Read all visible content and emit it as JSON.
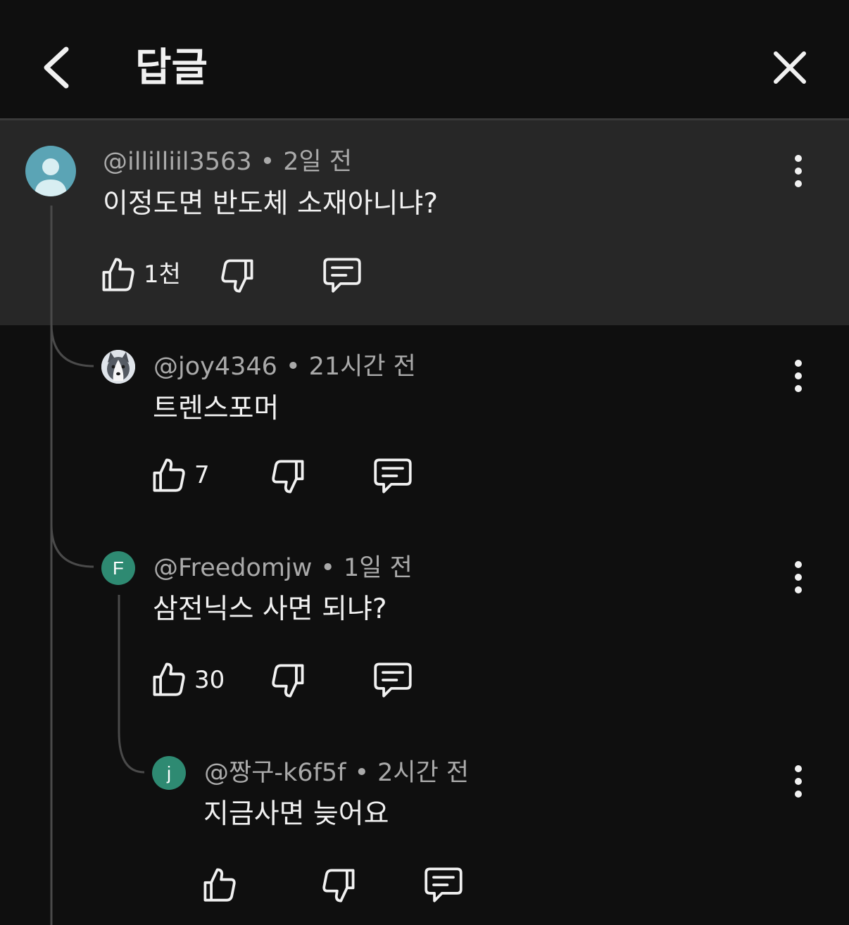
{
  "header": {
    "title": "답글",
    "back_icon": "chevron-left-icon",
    "close_icon": "close-icon"
  },
  "comments": [
    {
      "author": "@illilliil3563",
      "time": "2일 전",
      "text": "이정도면 반도체 소재아니냐?",
      "likes": "1천",
      "avatar_color": "#5ba4b5",
      "avatar_icon": "default-user-icon"
    },
    {
      "author": "@joy4346",
      "time": "21시간 전",
      "text": "트렌스포머",
      "likes": "7",
      "avatar_icon": "husky-photo"
    },
    {
      "author": "@Freedomjw",
      "time": "1일 전",
      "text": "삼전닉스 사면 되냐?",
      "likes": "30",
      "avatar_letter": "F",
      "avatar_color": "#2e8a72"
    },
    {
      "author": "@짱구-k6f5f",
      "time": "2시간 전",
      "text": "지금사면 늦어요",
      "likes": "",
      "avatar_letter": "j",
      "avatar_color": "#2e8a72"
    }
  ],
  "colors": {
    "background": "#0f0f0f",
    "highlight": "#272727",
    "text": "#f1f1f1",
    "meta": "#aaaaaa",
    "thread_line": "#4a4a4a"
  }
}
